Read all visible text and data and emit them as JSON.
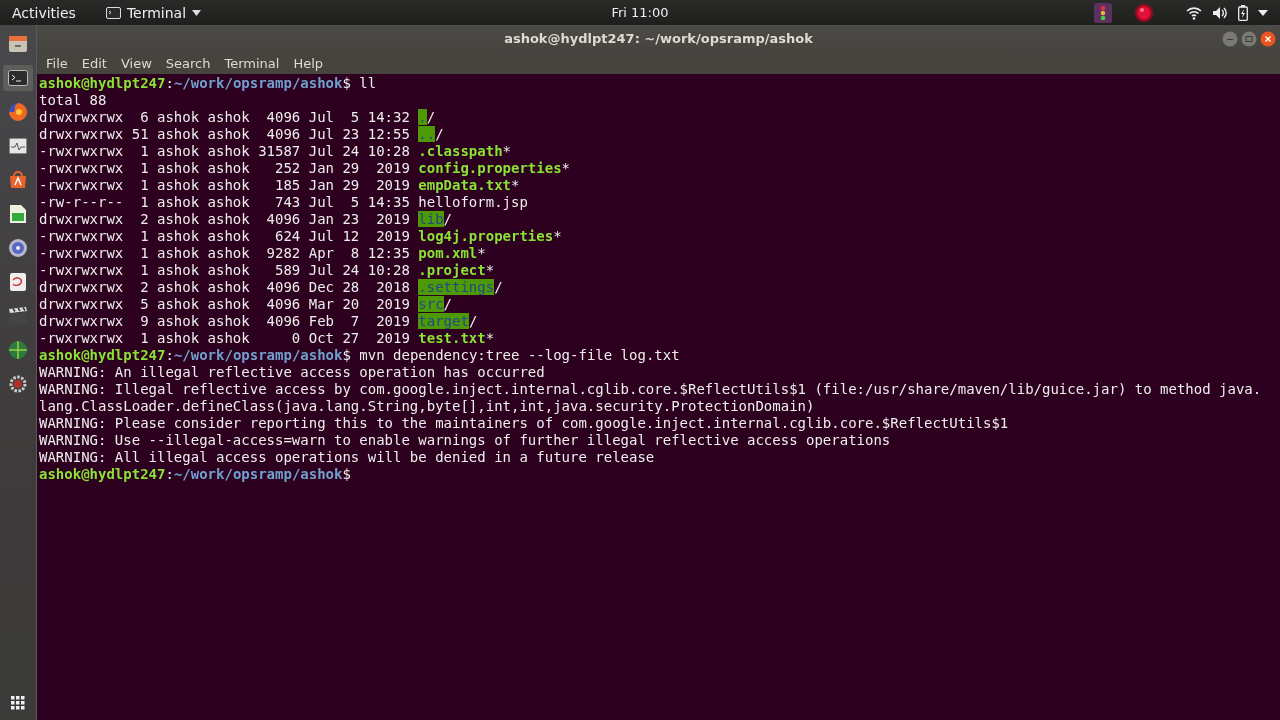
{
  "top_bar": {
    "activities": "Activities",
    "app_menu": "Terminal",
    "clock": "Fri 11:00"
  },
  "dock": {
    "items": [
      {
        "kind": "files",
        "selected": false
      },
      {
        "kind": "terminal",
        "selected": true
      },
      {
        "kind": "browser",
        "selected": false
      },
      {
        "kind": "monitor",
        "selected": false
      },
      {
        "kind": "software",
        "selected": false
      },
      {
        "kind": "editor",
        "selected": false
      },
      {
        "kind": "disc",
        "selected": false
      },
      {
        "kind": "document",
        "selected": false
      },
      {
        "kind": "video",
        "selected": false
      },
      {
        "kind": "globe",
        "selected": false
      },
      {
        "kind": "gear",
        "selected": false
      }
    ]
  },
  "window": {
    "title": "ashok@hydlpt247: ~/work/opsramp/ashok"
  },
  "menu": [
    "File",
    "Edit",
    "View",
    "Search",
    "Terminal",
    "Help"
  ],
  "terminal": {
    "lines": [
      {
        "kind": "prompt",
        "user": "ashok@hydlpt247",
        "separator": ":",
        "path": "~/work/opsramp/ashok",
        "symbol": "$",
        "command": " ll"
      },
      {
        "kind": "output",
        "text": "total 88"
      },
      {
        "kind": "entry",
        "info": "drwxrwxrwx  6 ashok ashok  4096 Jul  5 14:32 ",
        "file": {
          "kind": "dir",
          "text": ".",
          "suffix": "/"
        }
      },
      {
        "kind": "entry",
        "info": "drwxrwxrwx 51 ashok ashok  4096 Jul 23 12:55 ",
        "file": {
          "kind": "dir",
          "text": "..",
          "suffix": "/"
        }
      },
      {
        "kind": "entry",
        "info": "-rwxrwxrwx  1 ashok ashok 31587 Jul 24 10:28 ",
        "file": {
          "kind": "exec",
          "text": ".classpath",
          "suffix": "*"
        }
      },
      {
        "kind": "entry",
        "info": "-rwxrwxrwx  1 ashok ashok   252 Jan 29  2019 ",
        "file": {
          "kind": "exec",
          "text": "config.properties",
          "suffix": "*"
        }
      },
      {
        "kind": "entry",
        "info": "-rwxrwxrwx  1 ashok ashok   185 Jan 29  2019 ",
        "file": {
          "kind": "exec",
          "text": "empData.txt",
          "suffix": "*"
        }
      },
      {
        "kind": "entry",
        "info": "-rw-r--r--  1 ashok ashok   743 Jul  5 14:35 ",
        "file": {
          "kind": "plain",
          "text": "helloform.jsp"
        }
      },
      {
        "kind": "entry",
        "info": "drwxrwxrwx  2 ashok ashok  4096 Jan 23  2019 ",
        "file": {
          "kind": "dir",
          "text": "lib",
          "suffix": "/"
        }
      },
      {
        "kind": "entry",
        "info": "-rwxrwxrwx  1 ashok ashok   624 Jul 12  2019 ",
        "file": {
          "kind": "exec",
          "text": "log4j.properties",
          "suffix": "*"
        }
      },
      {
        "kind": "entry",
        "info": "-rwxrwxrwx  1 ashok ashok  9282 Apr  8 12:35 ",
        "file": {
          "kind": "exec",
          "text": "pom.xml",
          "suffix": "*"
        }
      },
      {
        "kind": "entry",
        "info": "-rwxrwxrwx  1 ashok ashok   589 Jul 24 10:28 ",
        "file": {
          "kind": "exec",
          "text": ".project",
          "suffix": "*"
        }
      },
      {
        "kind": "entry",
        "info": "drwxrwxrwx  2 ashok ashok  4096 Dec 28  2018 ",
        "file": {
          "kind": "dir",
          "text": ".settings",
          "suffix": "/"
        }
      },
      {
        "kind": "entry",
        "info": "drwxrwxrwx  5 ashok ashok  4096 Mar 20  2019 ",
        "file": {
          "kind": "dir",
          "text": "src",
          "suffix": "/"
        }
      },
      {
        "kind": "entry",
        "info": "drwxrwxrwx  9 ashok ashok  4096 Feb  7  2019 ",
        "file": {
          "kind": "dir",
          "text": "target",
          "suffix": "/"
        }
      },
      {
        "kind": "entry",
        "info": "-rwxrwxrwx  1 ashok ashok     0 Oct 27  2019 ",
        "file": {
          "kind": "exec",
          "text": "test.txt",
          "suffix": "*"
        }
      },
      {
        "kind": "prompt",
        "user": "ashok@hydlpt247",
        "separator": ":",
        "path": "~/work/opsramp/ashok",
        "symbol": "$",
        "command": " mvn dependency:tree --log-file log.txt"
      },
      {
        "kind": "output",
        "text": "WARNING: An illegal reflective access operation has occurred"
      },
      {
        "kind": "output",
        "text": "WARNING: Illegal reflective access by com.google.inject.internal.cglib.core.$ReflectUtils$1 (file:/usr/share/maven/lib/guice.jar) to method java."
      },
      {
        "kind": "output",
        "text": "lang.ClassLoader.defineClass(java.lang.String,byte[],int,int,java.security.ProtectionDomain)"
      },
      {
        "kind": "output",
        "text": "WARNING: Please consider reporting this to the maintainers of com.google.inject.internal.cglib.core.$ReflectUtils$1"
      },
      {
        "kind": "output",
        "text": "WARNING: Use --illegal-access=warn to enable warnings of further illegal reflective access operations"
      },
      {
        "kind": "output",
        "text": "WARNING: All illegal access operations will be denied in a future release"
      },
      {
        "kind": "prompt",
        "user": "ashok@hydlpt247",
        "separator": ":",
        "path": "~/work/opsramp/ashok",
        "symbol": "$"
      }
    ]
  }
}
